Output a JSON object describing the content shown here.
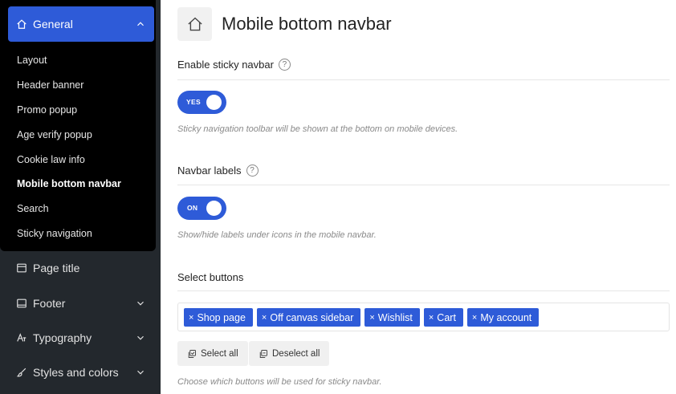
{
  "sidebar": {
    "general": {
      "label": "General",
      "icon": "home-icon"
    },
    "submenu": [
      {
        "label": "Layout",
        "active": false
      },
      {
        "label": "Header banner",
        "active": false
      },
      {
        "label": "Promo popup",
        "active": false
      },
      {
        "label": "Age verify popup",
        "active": false
      },
      {
        "label": "Cookie law info",
        "active": false
      },
      {
        "label": "Mobile bottom navbar",
        "active": true
      },
      {
        "label": "Search",
        "active": false
      },
      {
        "label": "Sticky navigation",
        "active": false
      }
    ],
    "sections": [
      {
        "label": "Page title",
        "icon": "page-title-icon"
      },
      {
        "label": "Footer",
        "icon": "footer-icon"
      },
      {
        "label": "Typography",
        "icon": "typography-icon"
      },
      {
        "label": "Styles and colors",
        "icon": "brush-icon"
      }
    ]
  },
  "page": {
    "title": "Mobile bottom navbar",
    "icon": "home-icon"
  },
  "fields": {
    "sticky": {
      "label": "Enable sticky navbar",
      "toggle_text": "YES",
      "enabled": true,
      "hint": "Sticky navigation toolbar will be shown at the bottom on mobile devices."
    },
    "labels": {
      "label": "Navbar labels",
      "toggle_text": "ON",
      "enabled": true,
      "hint": "Show/hide labels under icons in the mobile navbar."
    },
    "buttons": {
      "label": "Select buttons",
      "remove_glyph": "×",
      "selected": [
        "Shop page",
        "Off canvas sidebar",
        "Wishlist",
        "Cart",
        "My account"
      ],
      "select_all_label": "Select all",
      "deselect_all_label": "Deselect all",
      "hint": "Choose which buttons will be used for sticky navbar."
    }
  },
  "help_glyph": "?",
  "colors": {
    "accent": "#2e5bd8",
    "sidebar_bg": "#23282d",
    "submenu_bg": "#000000"
  }
}
